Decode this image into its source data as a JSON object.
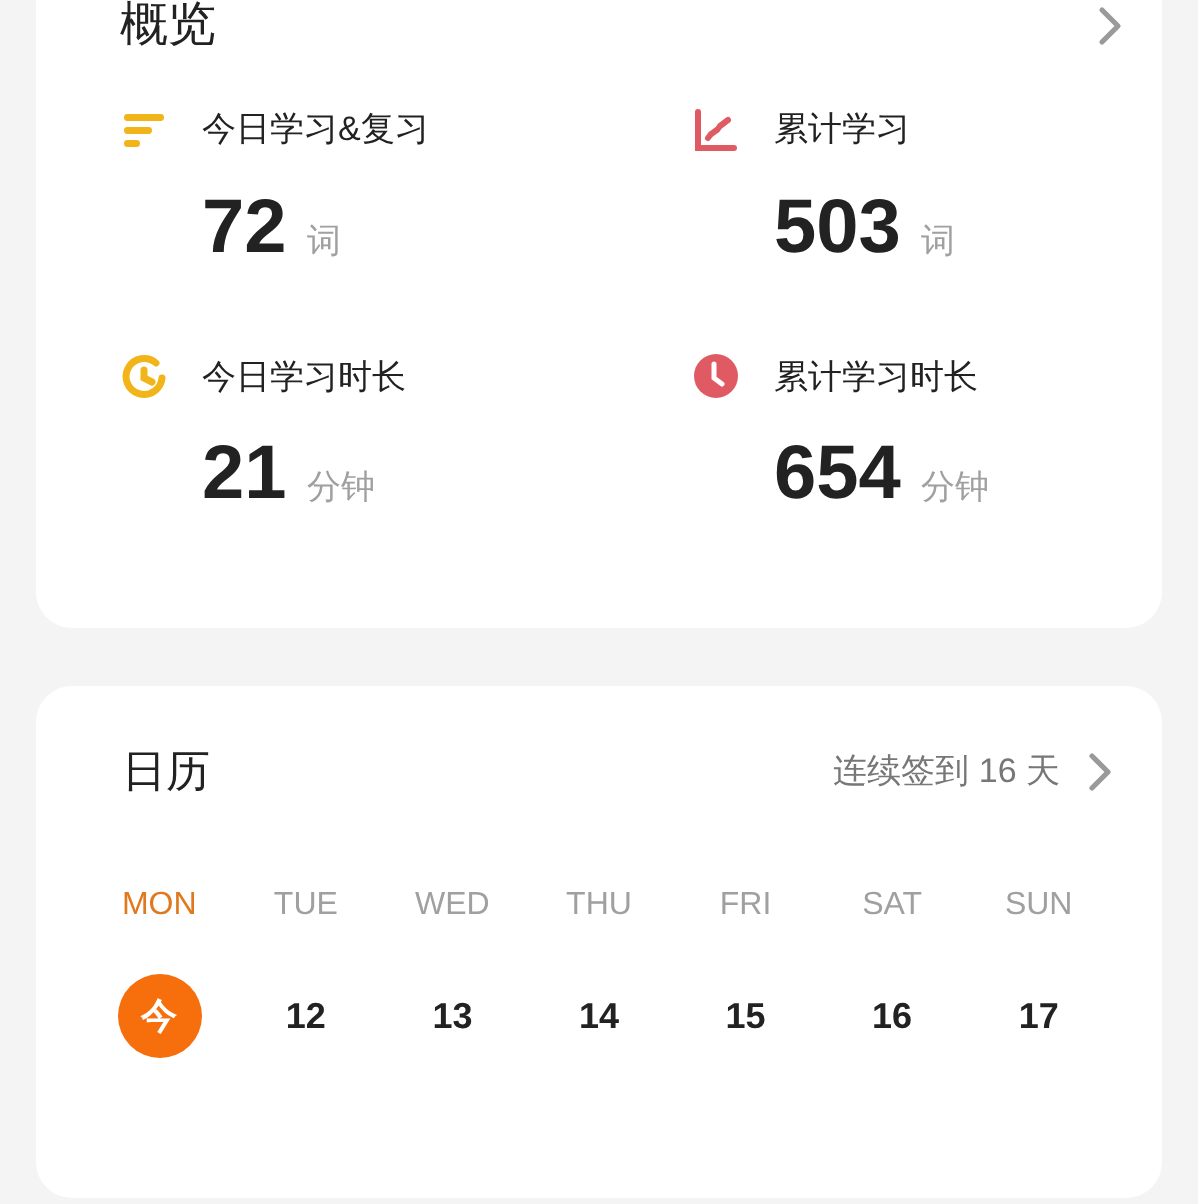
{
  "overview": {
    "title": "概览",
    "stats": [
      {
        "kind": "bars",
        "color": "#f2b519",
        "label": "今日学习&复习",
        "value": "72",
        "unit": "词"
      },
      {
        "kind": "chart",
        "color": "#e05a64",
        "label": "累计学习",
        "value": "503",
        "unit": "词"
      },
      {
        "kind": "gauge",
        "color": "#f2b519",
        "label": "今日学习时长",
        "value": "21",
        "unit": "分钟"
      },
      {
        "kind": "clock",
        "color": "#e05a64",
        "label": "累计学习时长",
        "value": "654",
        "unit": "分钟"
      }
    ]
  },
  "calendar": {
    "title": "日历",
    "streak": "连续签到 16 天",
    "days": [
      {
        "weekday": "MON",
        "date": "今",
        "selected": true
      },
      {
        "weekday": "TUE",
        "date": "12",
        "selected": false
      },
      {
        "weekday": "WED",
        "date": "13",
        "selected": false
      },
      {
        "weekday": "THU",
        "date": "14",
        "selected": false
      },
      {
        "weekday": "FRI",
        "date": "15",
        "selected": false
      },
      {
        "weekday": "SAT",
        "date": "16",
        "selected": false
      },
      {
        "weekday": "SUN",
        "date": "17",
        "selected": false
      }
    ]
  }
}
